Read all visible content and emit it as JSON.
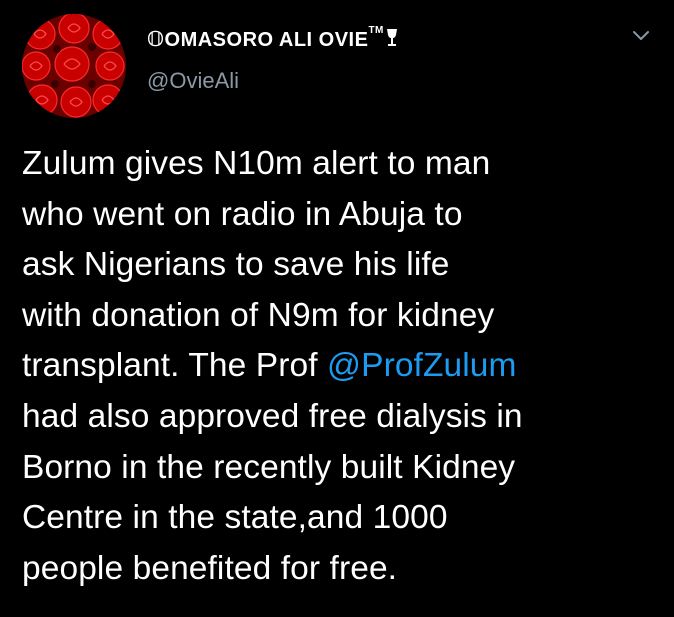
{
  "colors": {
    "background": "#000000",
    "text": "#ffffff",
    "secondary_text": "#8b98a5",
    "mention": "#1d9bf0",
    "avatar_rose": "#c80000"
  },
  "author": {
    "display_name_prefix": "𝕆",
    "display_name": "OMASORO ALI OVIE",
    "trademark": "TM",
    "badge_icon": "wine-glass-icon",
    "handle": "@OvieAli",
    "avatar_icon": "red-roses-avatar"
  },
  "menu": {
    "icon": "chevron-down-icon"
  },
  "tweet": {
    "line1": "Zulum gives N10m alert to man",
    "line2": "who went on radio in Abuja to",
    "line3": "ask Nigerians to save his life",
    "line4": "with donation of N9m for kidney",
    "line5_pre": "transplant. The Prof ",
    "mention": "@ProfZulum",
    "line6": "had also approved free dialysis in",
    "line7": "Borno in the recently built Kidney",
    "line8": "Centre in the state,and 1000",
    "line9": "people benefited for free."
  }
}
